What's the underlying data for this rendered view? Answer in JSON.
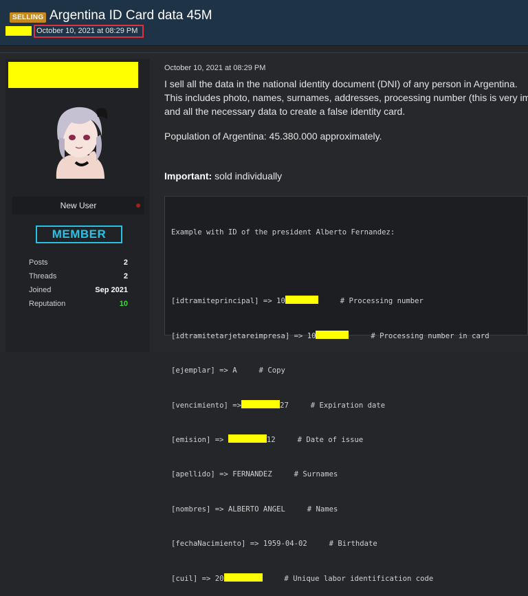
{
  "header": {
    "badge": "SELLING",
    "title": "Argentina ID Card data 45M",
    "date": "October 10, 2021 at 08:29 PM"
  },
  "author": {
    "role": "New User",
    "rank_badge": "MEMBER",
    "stats": [
      {
        "label": "Posts",
        "value": "2"
      },
      {
        "label": "Threads",
        "value": "2"
      },
      {
        "label": "Joined",
        "value": "Sep 2021"
      },
      {
        "label": "Reputation",
        "value": "10"
      }
    ],
    "colors": {
      "rank": "#29c2e6",
      "reputation": "#3ddc3d",
      "badge": "#c5891f"
    }
  },
  "post": {
    "date": "October 10, 2021 at 08:29 PM",
    "lines": [
      "I sell all the data in the national identity document (DNI) of any person in Argentina.",
      "This includes photo, names, surnames, addresses, processing number (this is very imp",
      "and all the necessary data to create a false identity card."
    ],
    "population": "Population of Argentina: 45.380.000 approximately.",
    "important_label": "Important:",
    "important_text": " sold individually"
  },
  "code": {
    "header": "Example with ID of the president Alberto Fernandez:",
    "rows": [
      {
        "pre": "[idtramiteprincipal] => 10",
        "post": "     # Processing number"
      },
      {
        "pre": "[idtramitetarjetareimpresa] => 10",
        "post": "     # Processing number in card"
      },
      {
        "pre": "[ejemplar] => A     # Copy",
        "post": ""
      },
      {
        "pre": "[vencimiento] =>",
        "post": "27     # Expiration date"
      },
      {
        "pre": "[emision] => ",
        "post": "12     # Date of issue"
      },
      {
        "pre": "[apellido] => FERNANDEZ     # Surnames",
        "post": ""
      },
      {
        "pre": "[nombres] => ALBERTO ANGEL     # Names",
        "post": ""
      },
      {
        "pre": "[fechaNacimiento] => 1959-04-02     # Birthdate",
        "post": ""
      },
      {
        "pre": "[cuil] => 20",
        "post": "     # Unique labor identification code"
      }
    ]
  }
}
